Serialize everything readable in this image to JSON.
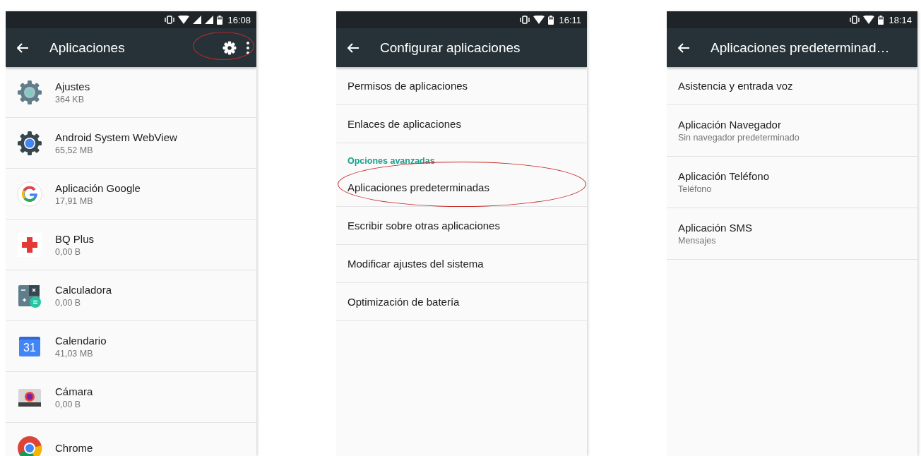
{
  "screens": [
    {
      "status": {
        "time": "16:08"
      },
      "title": "Aplicaciones",
      "actions": [
        {
          "kind": "settings",
          "highlighted": true
        },
        {
          "kind": "overflow",
          "highlighted": false
        }
      ],
      "items": [
        {
          "kind": "app",
          "title": "Ajustes",
          "subtitle": "364 KB",
          "highlighted": false
        },
        {
          "kind": "app",
          "title": "Android System WebView",
          "subtitle": "65,52 MB",
          "highlighted": false
        },
        {
          "kind": "app",
          "title": "Aplicación Google",
          "subtitle": "17,91 MB",
          "highlighted": false
        },
        {
          "kind": "app",
          "title": "BQ Plus",
          "subtitle": "0,00 B",
          "highlighted": false
        },
        {
          "kind": "app",
          "title": "Calculadora",
          "subtitle": "0,00 B",
          "highlighted": false
        },
        {
          "kind": "app",
          "icon_label": "31",
          "title": "Calendario",
          "subtitle": "41,03 MB",
          "highlighted": false
        },
        {
          "kind": "app",
          "title": "Cámara",
          "subtitle": "0,00 B",
          "highlighted": false
        },
        {
          "kind": "app",
          "title": "Chrome",
          "highlighted": false
        }
      ]
    },
    {
      "status": {
        "time": "16:11"
      },
      "title": "Configurar aplicaciones",
      "items": [
        {
          "kind": "item",
          "title": "Permisos de aplicaciones",
          "highlighted": false
        },
        {
          "kind": "item",
          "title": "Enlaces de aplicaciones",
          "highlighted": false
        },
        {
          "kind": "header",
          "title": "Opciones avanzadas"
        },
        {
          "kind": "item",
          "title": "Aplicaciones predeterminadas",
          "highlighted": true
        },
        {
          "kind": "item",
          "title": "Escribir sobre otras aplicaciones",
          "highlighted": false
        },
        {
          "kind": "item",
          "title": "Modificar ajustes del sistema",
          "highlighted": false
        },
        {
          "kind": "item",
          "title": "Optimización de batería",
          "highlighted": false
        }
      ]
    },
    {
      "status": {
        "time": "18:14"
      },
      "title": "Aplicaciones predeterminad…",
      "items": [
        {
          "kind": "item",
          "title": "Asistencia y entrada voz",
          "highlighted": false
        },
        {
          "kind": "item",
          "title": "Aplicación Navegador",
          "subtitle": "Sin navegador predeterminado",
          "highlighted": false
        },
        {
          "kind": "item",
          "title": "Aplicación Teléfono",
          "subtitle": "Teléfono",
          "highlighted": false
        },
        {
          "kind": "item",
          "title": "Aplicación SMS",
          "subtitle": "Mensajes",
          "highlighted": false
        }
      ]
    }
  ]
}
